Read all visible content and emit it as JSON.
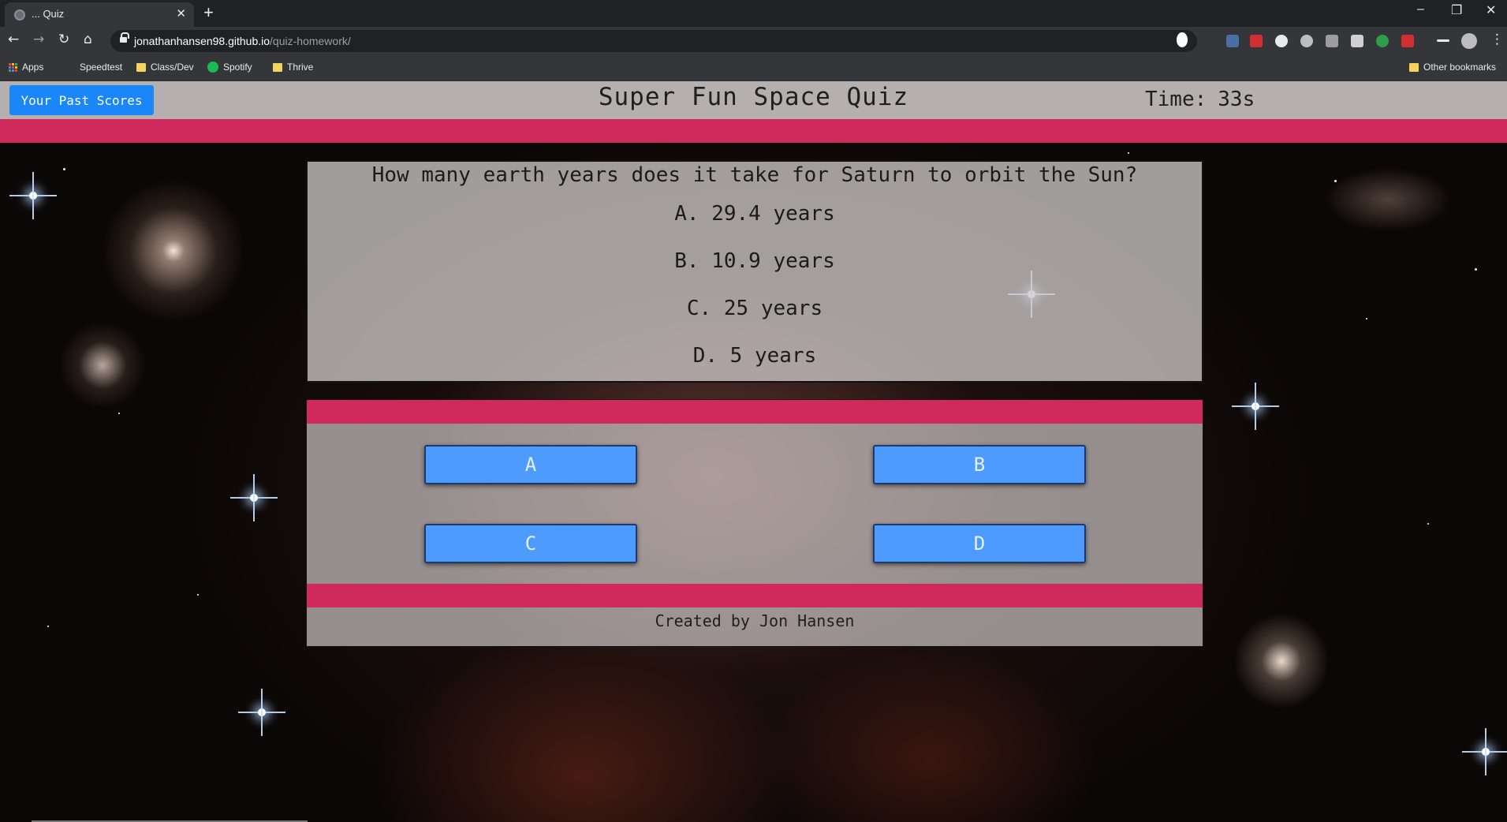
{
  "browser": {
    "tab_title": "... Quiz",
    "tab_close": "✕",
    "new_tab": "+",
    "url_host": "jonathanhansen98.github.io",
    "url_path": "/quiz-homework/",
    "bookmarks": [
      {
        "label": "Apps",
        "icon": "apps-grid-icon"
      },
      {
        "label": "Speedtest",
        "icon": "none"
      },
      {
        "label": "Class/Dev",
        "icon": "folder-icon"
      },
      {
        "label": "Spotify",
        "icon": "spotify-icon"
      },
      {
        "label": "Thrive",
        "icon": "folder-icon"
      }
    ],
    "other_bookmarks": "Other bookmarks",
    "accent": "#35363a"
  },
  "header": {
    "past_scores_label": "Your Past Scores",
    "title": "Super Fun Space Quiz",
    "timer_label": "Time:",
    "timer_value": "33s"
  },
  "question": {
    "text": "How many earth years does it take for Saturn to orbit the Sun?",
    "choices": [
      "A. 29.4 years",
      "B. 10.9 years",
      "C. 25 years",
      "D. 5 years"
    ]
  },
  "answers": {
    "buttons": [
      "A",
      "B",
      "C",
      "D"
    ]
  },
  "footer": {
    "credit": "Created by Jon Hansen"
  },
  "colors": {
    "stripe": "#cf2a5b",
    "button_blue": "#4d9bff",
    "past_scores_blue": "#1a86f8"
  }
}
